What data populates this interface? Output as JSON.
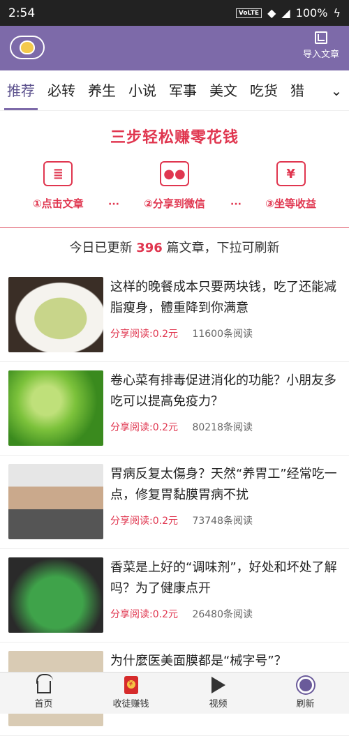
{
  "status_bar": {
    "time": "2:54",
    "volte": "VoLTE",
    "battery": "100%"
  },
  "header": {
    "import_label": "导入文章",
    "accent": "#7d6aa9"
  },
  "tabs": [
    {
      "label": "推荐",
      "active": true
    },
    {
      "label": "必转"
    },
    {
      "label": "养生"
    },
    {
      "label": "小说"
    },
    {
      "label": "军事"
    },
    {
      "label": "美文"
    },
    {
      "label": "吃货"
    },
    {
      "label": "猎"
    }
  ],
  "banner": {
    "title": "三步轻松赚零花钱",
    "steps": [
      {
        "icon": "document-icon",
        "label": "①点击文章"
      },
      {
        "icon": "wechat-icon",
        "label": "②分享到微信"
      },
      {
        "icon": "yen-icon",
        "label": "③坐等收益",
        "glyph": "¥"
      }
    ],
    "separator": "···"
  },
  "update": {
    "prefix": "今日已更新",
    "count": "396",
    "suffix": "篇文章，下拉可刷新"
  },
  "articles": [
    {
      "title": "这样的晚餐成本只要两块钱，吃了还能减脂瘦身，體重降到你满意",
      "share": "分享阅读:0.2元",
      "reads": "11600条阅读"
    },
    {
      "title": "卷心菜有排毒促进消化的功能？小朋友多吃可以提高免疫力？",
      "share": "分享阅读:0.2元",
      "reads": "80218条阅读"
    },
    {
      "title": "胃病反复太傷身？天然“养胃工”经常吃一点，修复胃黏膜胃病不扰",
      "share": "分享阅读:0.2元",
      "reads": "73748条阅读"
    },
    {
      "title": "香菜是上好的“调味剂”，好处和坏处了解吗？为了健康点开",
      "share": "分享阅读:0.2元",
      "reads": "26480条阅读"
    },
    {
      "title": "为什麼医美面膜都是“械字号”？",
      "share": "",
      "reads": ""
    }
  ],
  "bottom_nav": [
    {
      "label": "首页",
      "icon": "home-icon"
    },
    {
      "label": "收徒赚钱",
      "icon": "red-envelope-icon"
    },
    {
      "label": "视频",
      "icon": "play-icon"
    },
    {
      "label": "刷新",
      "icon": "refresh-icon"
    }
  ]
}
